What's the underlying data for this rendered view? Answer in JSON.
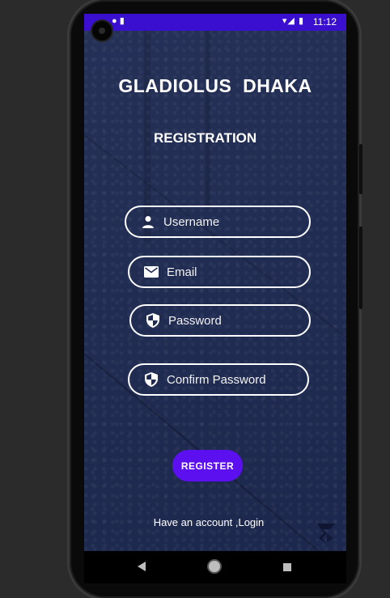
{
  "status_bar": {
    "time": "11:12",
    "left_icons": "● ▮",
    "right_icons": "▾◢ ▮"
  },
  "app": {
    "title": "GLADIOLUS  DHAKA",
    "subtitle": "REGISTRATION"
  },
  "form": {
    "username_placeholder": "Username",
    "email_placeholder": "Email",
    "password_placeholder": "Password",
    "confirm_password_placeholder": "Confirm Password",
    "register_label": "REGISTER",
    "login_link": "Have an account ,Login"
  },
  "colors": {
    "status_bar": "#3a0fd0",
    "background": "#1e2a52",
    "accent": "#5c10f0"
  },
  "icons": {
    "username": "person-icon",
    "email": "mail-icon",
    "password": "shield-icon",
    "confirm_password": "shield-icon"
  },
  "navigation": {
    "back": "back-triangle-icon",
    "home": "home-circle-icon",
    "recents": "recents-square-icon"
  }
}
